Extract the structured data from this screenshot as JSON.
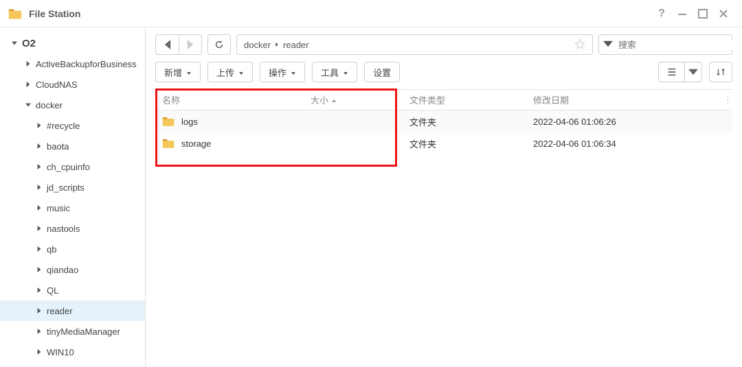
{
  "app": {
    "title": "File Station"
  },
  "window_controls": {
    "help": "?",
    "minimize": "min",
    "maximize": "max",
    "close": "close"
  },
  "tree": {
    "root": "O2",
    "top_level": [
      {
        "label": "ActiveBackupforBusiness",
        "expanded": false
      },
      {
        "label": "CloudNAS",
        "expanded": false
      }
    ],
    "docker": {
      "label": "docker",
      "expanded": true,
      "children": [
        {
          "label": "#recycle"
        },
        {
          "label": "baota"
        },
        {
          "label": "ch_cpuinfo"
        },
        {
          "label": "jd_scripts"
        },
        {
          "label": "music"
        },
        {
          "label": "nastools"
        },
        {
          "label": "qb"
        },
        {
          "label": "qiandao"
        },
        {
          "label": "QL"
        },
        {
          "label": "reader",
          "selected": true
        },
        {
          "label": "tinyMediaManager"
        },
        {
          "label": "WIN10"
        }
      ]
    }
  },
  "breadcrumb": {
    "parts": [
      "docker",
      "reader"
    ]
  },
  "search": {
    "placeholder": "搜索"
  },
  "toolbar": {
    "new": "新增",
    "upload": "上传",
    "action": "操作",
    "tools": "工具",
    "settings": "设置"
  },
  "columns": {
    "name": "名称",
    "size": "大小",
    "type": "文件类型",
    "modified": "修改日期"
  },
  "rows": [
    {
      "name": "logs",
      "size": "",
      "type": "文件夹",
      "modified": "2022-04-06 01:06:26"
    },
    {
      "name": "storage",
      "size": "",
      "type": "文件夹",
      "modified": "2022-04-06 01:06:34"
    }
  ]
}
